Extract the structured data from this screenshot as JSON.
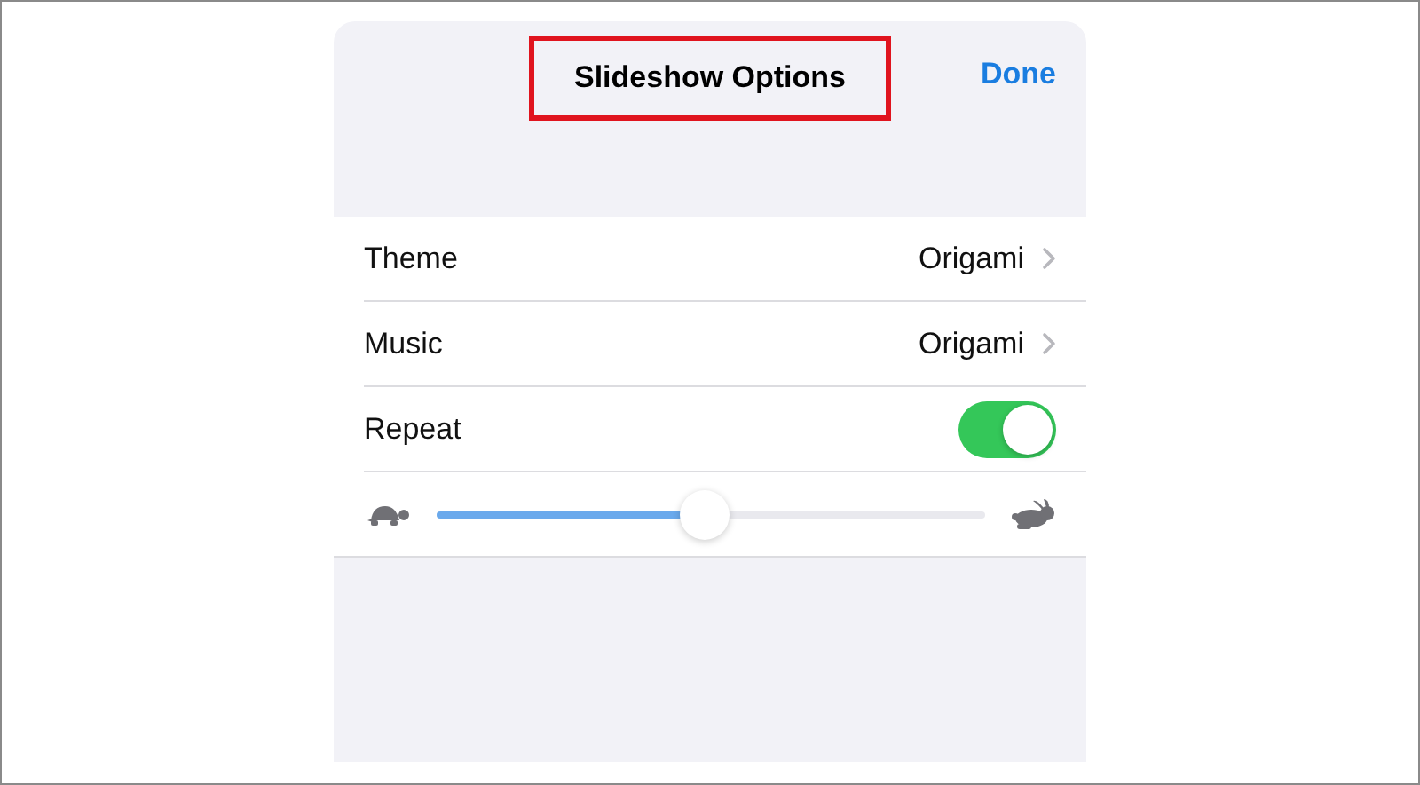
{
  "header": {
    "title": "Slideshow Options",
    "title_highlighted": true,
    "done": "Done"
  },
  "rows": [
    {
      "kind": "link",
      "label": "Theme",
      "value": "Origami"
    },
    {
      "kind": "link",
      "label": "Music",
      "value": "Origami"
    },
    {
      "kind": "toggle",
      "label": "Repeat",
      "on": true
    },
    {
      "kind": "slider",
      "level": 0.49
    }
  ]
}
